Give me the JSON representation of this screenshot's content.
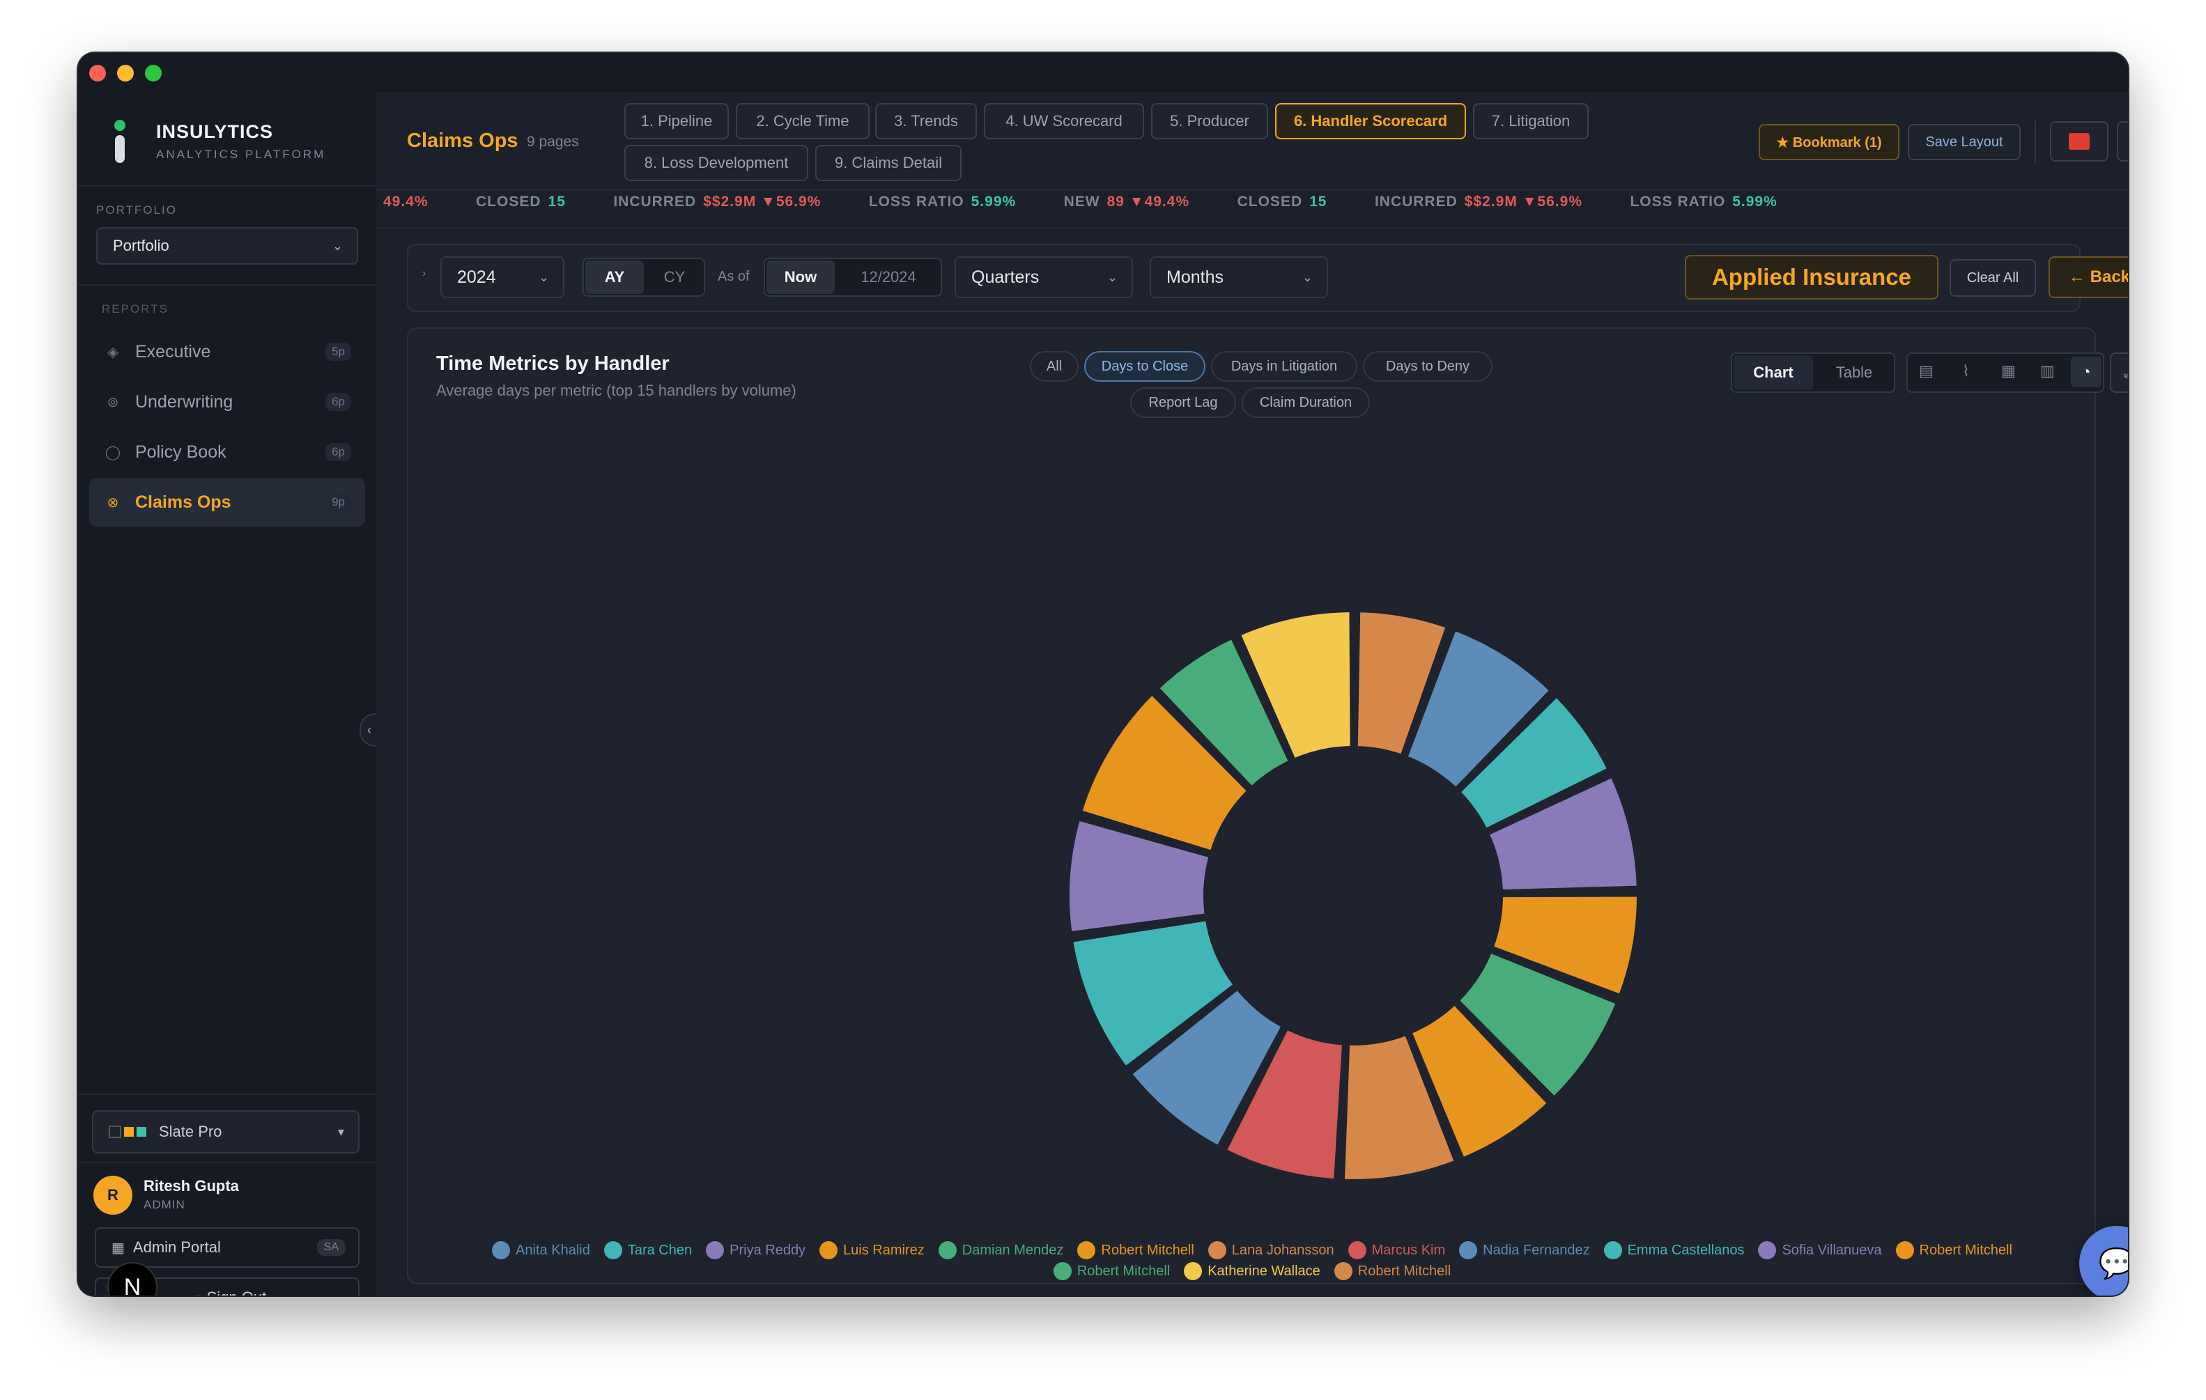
{
  "brand": {
    "name": "INSULYTICS",
    "tagline": "ANALYTICS PLATFORM"
  },
  "sidebar": {
    "portfolio_label": "PORTFOLIO",
    "portfolio_value": "Portfolio",
    "reports_label": "REPORTS",
    "items": [
      {
        "label": "Executive",
        "badge": "5p",
        "icon": "diamond-icon"
      },
      {
        "label": "Underwriting",
        "badge": "6p",
        "icon": "target-icon"
      },
      {
        "label": "Policy Book",
        "badge": "6p",
        "icon": "circle-icon"
      },
      {
        "label": "Claims Ops",
        "badge": "9p",
        "icon": "target-icon",
        "active": true
      }
    ],
    "theme_label": "Slate Pro",
    "user": {
      "initial": "R",
      "name": "Ritesh Gupta",
      "role": "ADMIN"
    },
    "admin_portal": "Admin Portal",
    "admin_badge": "SA",
    "sign_out": "Sign Out",
    "floating_badge": "N"
  },
  "header": {
    "section_title": "Claims Ops",
    "page_count": "9 pages",
    "tabs": [
      "1. Pipeline",
      "2. Cycle Time",
      "3. Trends",
      "4. UW Scorecard",
      "5. Producer",
      "6. Handler Scorecard",
      "7. Litigation",
      "8. Loss Development",
      "9. Claims Detail"
    ],
    "active_tab": "6. Handler Scorecard",
    "bookmark": "★ Bookmark (1)",
    "save_layout": "Save Layout"
  },
  "ticker": [
    {
      "label": "",
      "value": "49.4%",
      "color": "red"
    },
    {
      "label": "CLOSED",
      "value": "15",
      "color": "green"
    },
    {
      "label": "INCURRED",
      "value": "$$2.9M ▼56.9%",
      "color": "red"
    },
    {
      "label": "LOSS RATIO",
      "value": "5.99%",
      "color": "green"
    },
    {
      "label": "NEW",
      "value": "89 ▼49.4%",
      "color": "red"
    },
    {
      "label": "CLOSED",
      "value": "15",
      "color": "green"
    },
    {
      "label": "INCURRED",
      "value": "$$2.9M ▼56.9%",
      "color": "red"
    },
    {
      "label": "LOSS RATIO",
      "value": "5.99%",
      "color": "green"
    }
  ],
  "filters": {
    "year": "2024",
    "ay": "AY",
    "cy": "CY",
    "as_of": "As of",
    "now": "Now",
    "date": "12/2024",
    "quarters": "Quarters",
    "months": "Months",
    "company": "Applied Insurance",
    "clear_all": "Clear All",
    "back": "← Back"
  },
  "panel": {
    "title": "Time Metrics by Handler",
    "subtitle": "Average days per metric (top 15 handlers by volume)",
    "metric_chips": [
      "All",
      "Days to Close",
      "Days in Litigation",
      "Days to Deny",
      "Report Lag",
      "Claim Duration"
    ],
    "active_chip": "Days to Close",
    "view_chart": "Chart",
    "view_table": "Table"
  },
  "chart_data": {
    "type": "pie",
    "donut": true,
    "title": "Time Metrics by Handler",
    "series": [
      {
        "name": "Anita Khalid",
        "value": 10,
        "color": "#5b8db8"
      },
      {
        "name": "Tara Chen",
        "value": 8,
        "color": "#41b6b6"
      },
      {
        "name": "Priya Reddy",
        "value": 10,
        "color": "#8a7bb8"
      },
      {
        "name": "Luis Ramirez",
        "value": 9,
        "color": "#e8951e"
      },
      {
        "name": "Damian Mendez",
        "value": 10,
        "color": "#49ad7b"
      },
      {
        "name": "Robert Mitchell",
        "value": 9,
        "color": "#e8951e"
      },
      {
        "name": "Lana Johansson",
        "value": 10,
        "color": "#d6874a"
      },
      {
        "name": "Marcus Kim",
        "value": 10,
        "color": "#d35858"
      },
      {
        "name": "Nadia Fernandez",
        "value": 10,
        "color": "#5b8db8"
      },
      {
        "name": "Emma Castellanos",
        "value": 12,
        "color": "#41b6b6"
      },
      {
        "name": "Sofia Villanueva",
        "value": 10,
        "color": "#8a7bb8"
      },
      {
        "name": "Robert Mitchell",
        "value": 12,
        "color": "#e8951e"
      },
      {
        "name": "Robert Mitchell",
        "value": 8,
        "color": "#49ad7b"
      },
      {
        "name": "Katherine Wallace",
        "value": 10,
        "color": "#f2c94c"
      },
      {
        "name": "Robert Mitchell",
        "value": 8,
        "color": "#d6874a"
      }
    ]
  },
  "colors": {
    "accent": "#f5a623",
    "background": "#1b202a",
    "panel": "#1e232d"
  }
}
